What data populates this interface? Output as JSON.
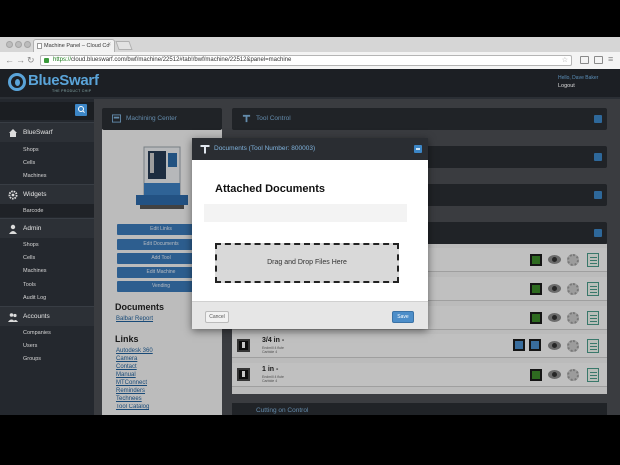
{
  "browser": {
    "tab_title": "Machine Panel – Cloud Co",
    "url_secure": "https://",
    "url_rest": "cloud.blueswarf.com/bwf/machine/22512#tab!/bwf/machine/22512&panel=machine"
  },
  "header": {
    "logo": "BlueSwarf",
    "logo_sub": "THE PRODUCT CHIP",
    "hello": "Hello, Dave Baker",
    "logout": "Logout"
  },
  "sidebar": {
    "sections": [
      {
        "label": "BlueSwarf",
        "items": [
          "Shops",
          "Cells",
          "Machines"
        ]
      },
      {
        "label": "Widgets",
        "items": [
          "Barcode"
        ]
      },
      {
        "label": "Admin",
        "items": [
          "Shops",
          "Cells",
          "Machines",
          "Tools",
          "Audit Log"
        ]
      },
      {
        "label": "Accounts",
        "items": [
          "Companies",
          "Users",
          "Groups"
        ]
      }
    ]
  },
  "machining_center": {
    "title": "Machining Center",
    "buttons": [
      "Edit Links",
      "Edit Documents",
      "Add Tool",
      "Edit Machine",
      "Vending"
    ]
  },
  "documents": {
    "title": "Documents",
    "items": [
      "Balbar Report"
    ]
  },
  "links": {
    "title": "Links",
    "items": [
      "Autodesk 360",
      "Camera",
      "Contact",
      "Manual",
      "MTConnect",
      "Reminders",
      "Technees",
      "Tool Catalog"
    ]
  },
  "tool_control": {
    "title": "Tool Control"
  },
  "tools": [
    {
      "name": "3/4 in -",
      "sub1": "Endmill 4 flute",
      "sub2": "Carbide 4"
    },
    {
      "name": "1 in -",
      "sub1": "Endmill 4 flute",
      "sub2": "Carbide 4"
    }
  ],
  "bottom_panel": {
    "title": "Cutting on Control"
  },
  "modal": {
    "title": "Documents (Tool Number: 800003)",
    "heading": "Attached Documents",
    "dropzone": "Drag and Drop Files Here",
    "cancel": "Cancel",
    "save": "Save"
  },
  "colors": {
    "accent": "#3c86c6",
    "status_green": "#3c8a2a",
    "header_dark": "#1c1f24"
  }
}
